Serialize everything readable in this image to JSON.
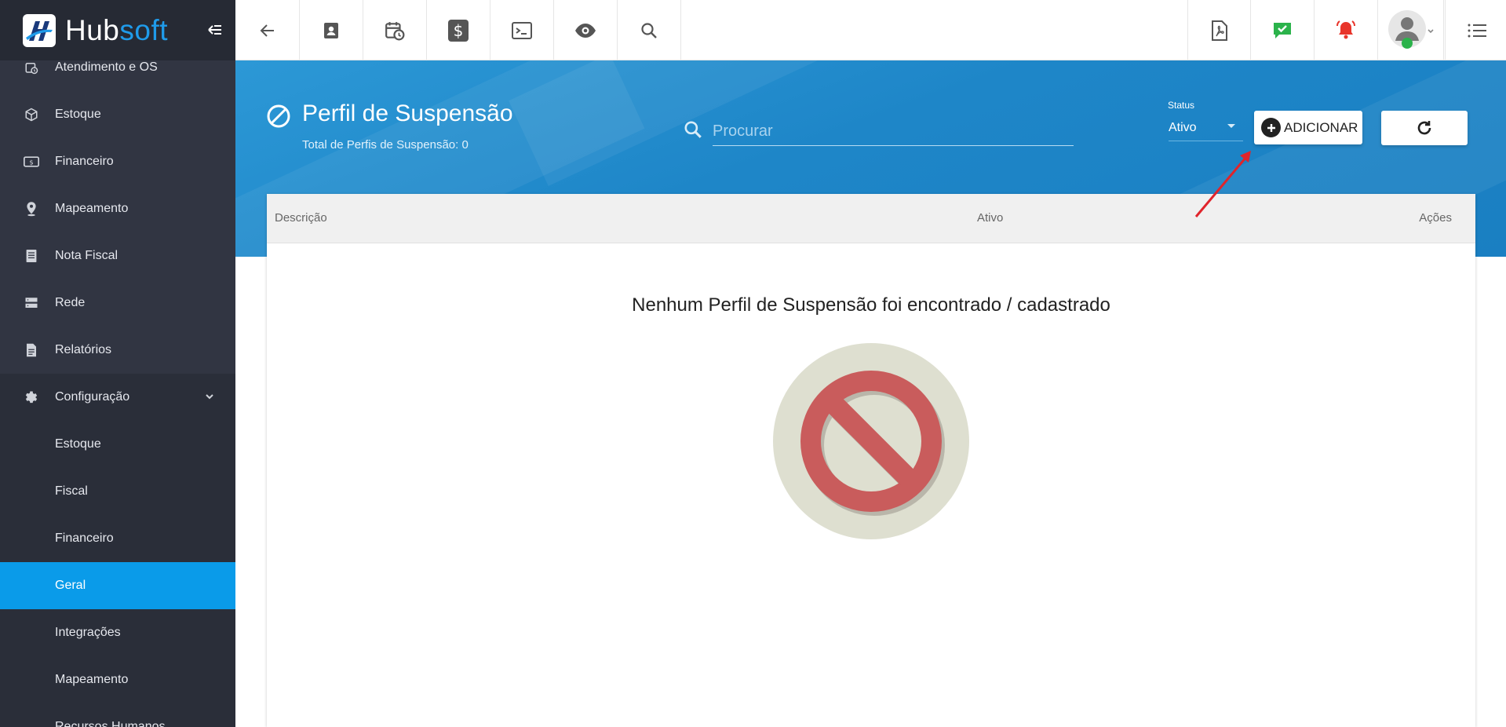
{
  "brand": {
    "part1": "Hub",
    "part2": "soft"
  },
  "sidebar": {
    "items": [
      {
        "label": "Atendimento e OS",
        "icon": "calendar-clock-icon"
      },
      {
        "label": "Estoque",
        "icon": "box-icon"
      },
      {
        "label": "Financeiro",
        "icon": "money-icon"
      },
      {
        "label": "Mapeamento",
        "icon": "map-pin-icon"
      },
      {
        "label": "Nota Fiscal",
        "icon": "document-icon"
      },
      {
        "label": "Rede",
        "icon": "server-icon"
      },
      {
        "label": "Relatórios",
        "icon": "report-icon"
      },
      {
        "label": "Configuração",
        "icon": "gear-icon"
      }
    ],
    "config_sub": [
      {
        "label": "Estoque"
      },
      {
        "label": "Fiscal"
      },
      {
        "label": "Financeiro"
      },
      {
        "label": "Geral",
        "active": true
      },
      {
        "label": "Integrações"
      },
      {
        "label": "Mapeamento"
      },
      {
        "label": "Recursos Humanos"
      }
    ]
  },
  "page": {
    "title": "Perfil de Suspensão",
    "subtitle": "Total de Perfis de Suspensão: 0"
  },
  "search": {
    "placeholder": "Procurar"
  },
  "status": {
    "label": "Status",
    "value": "Ativo"
  },
  "actions": {
    "add_label": "ADICIONAR"
  },
  "table": {
    "columns": [
      "Descrição",
      "Ativo",
      "Ações"
    ],
    "empty_message": "Nenhum Perfil de Suspensão foi encontrado / cadastrado"
  },
  "colors": {
    "sidebar_bg": "#313542",
    "active_item": "#0a9be9",
    "banner": "#1e86c8",
    "brand_accent": "#1f9bea",
    "chat_green": "#2bb34b",
    "bell_red": "#e8352b",
    "empty_icon_red": "#c95c5c",
    "empty_icon_bg": "#dedfd0"
  }
}
